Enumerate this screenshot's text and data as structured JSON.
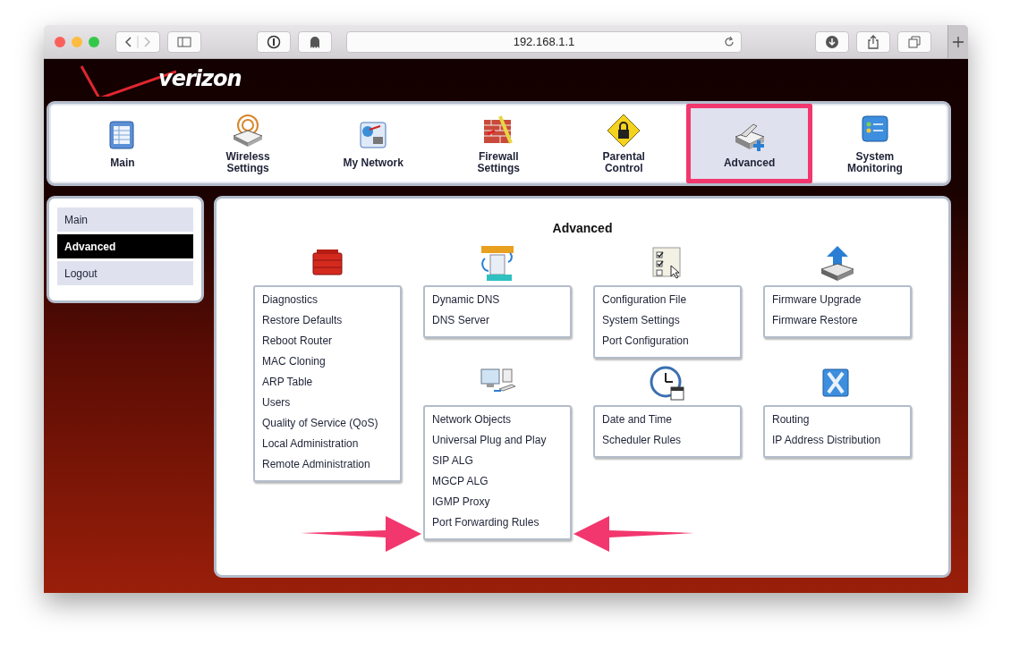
{
  "browser": {
    "url": "192.168.1.1"
  },
  "logo": {
    "text": "verizon"
  },
  "nav": [
    {
      "label": "Main",
      "selected": false,
      "highlighted": false
    },
    {
      "label": "Wireless Settings",
      "selected": false,
      "highlighted": false
    },
    {
      "label": "My Network",
      "selected": false,
      "highlighted": false
    },
    {
      "label": "Firewall Settings",
      "selected": false,
      "highlighted": false
    },
    {
      "label": "Parental Control",
      "selected": false,
      "highlighted": false
    },
    {
      "label": "Advanced",
      "selected": true,
      "highlighted": true
    },
    {
      "label": "System Monitoring",
      "selected": false,
      "highlighted": false
    }
  ],
  "sidebar": {
    "items": [
      {
        "label": "Main",
        "selected": false
      },
      {
        "label": "Advanced",
        "selected": true
      },
      {
        "label": "Logout",
        "selected": false
      }
    ]
  },
  "panel": {
    "title": "Advanced",
    "groups": [
      {
        "items": [
          "Diagnostics",
          "Restore Defaults",
          "Reboot Router",
          "MAC Cloning",
          "ARP Table",
          "Users",
          "Quality of Service (QoS)",
          "Local Administration",
          "Remote Administration"
        ]
      },
      {
        "items": [
          "Dynamic DNS",
          "DNS Server"
        ]
      },
      {
        "items": [
          "Configuration File",
          "System Settings",
          "Port Configuration"
        ]
      },
      {
        "items": [
          "Firmware Upgrade",
          "Firmware Restore"
        ]
      },
      {
        "items": [
          "Network Objects",
          "Universal Plug and Play",
          "SIP ALG",
          "MGCP ALG",
          "IGMP Proxy",
          "Port Forwarding Rules"
        ]
      },
      {
        "items": [
          "Date and Time",
          "Scheduler Rules"
        ]
      },
      {
        "items": [
          "Routing",
          "IP Address Distribution"
        ]
      }
    ]
  },
  "annotations": [
    {
      "kind": "arrow"
    },
    {
      "kind": "arrow"
    }
  ]
}
